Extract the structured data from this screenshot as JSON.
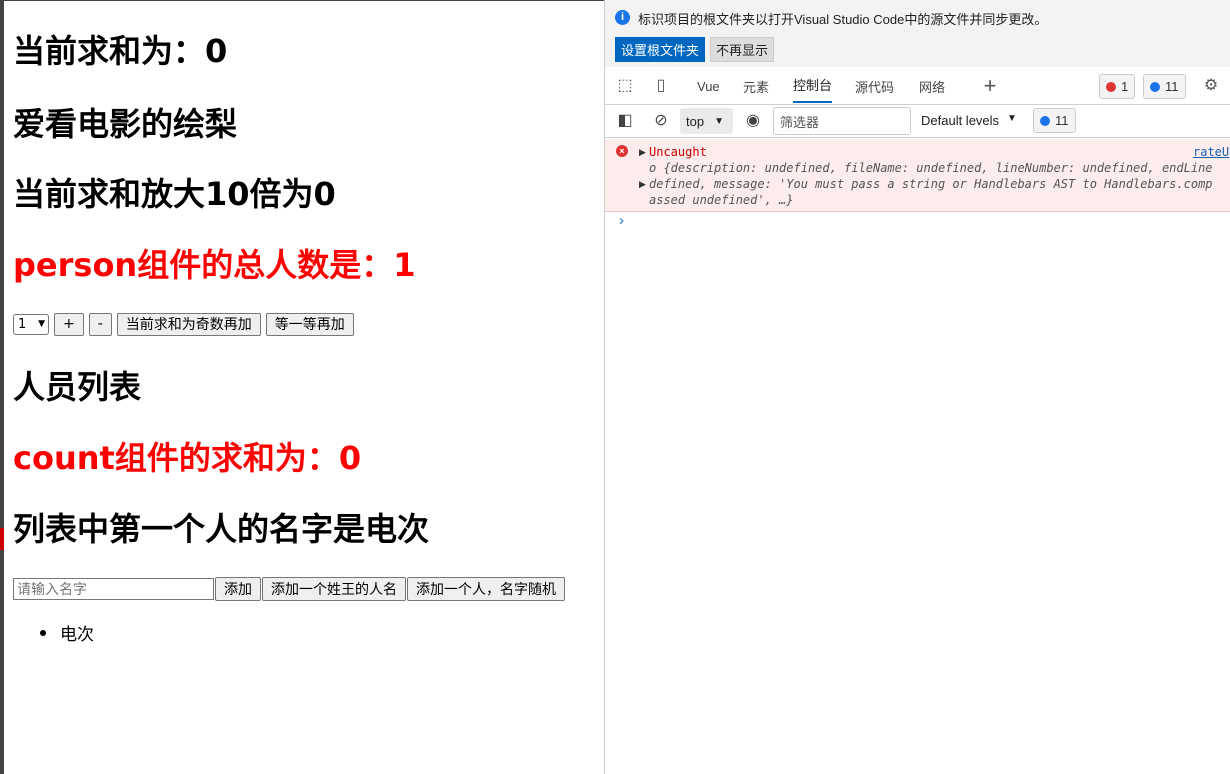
{
  "page": {
    "headings": {
      "sum": "当前求和为：0",
      "hobby": "爱看电影的绘梨",
      "scaled": "当前求和放大10倍为0",
      "person_count": "person组件的总人数是：1",
      "person_list": "人员列表",
      "count_sum": "count组件的求和为：0",
      "first_name": "列表中第一个人的名字是电次"
    },
    "controls": {
      "select_value": "1",
      "plus": "+",
      "minus": "-",
      "odd_add": "当前求和为奇数再加",
      "wait_add": "等一等再加"
    },
    "person_form": {
      "name_placeholder": "请输入名字",
      "add": "添加",
      "add_wang": "添加一个姓王的人名",
      "add_random": "添加一个人，名字随机"
    },
    "list": [
      "电次"
    ]
  },
  "devtools": {
    "infobar": {
      "message": "标识项目的根文件夹以打开Visual Studio Code中的源文件并同步更改。",
      "set_root": "设置根文件夹",
      "dismiss": "不再显示"
    },
    "tabs": [
      "Vue",
      "元素",
      "控制台",
      "源代码",
      "网络"
    ],
    "active_tab": "控制台",
    "error_count": "1",
    "message_count": "11",
    "toolbar": {
      "context": "top",
      "filter_placeholder": "筛选器",
      "levels": "Default levels",
      "messages": "11"
    },
    "error": {
      "title": "Uncaught",
      "source": "rateU",
      "line1": "o {description: undefined, fileName: undefined, lineNumber: undefined, endLine",
      "line2": "defined, message: 'You must pass a string or Handlebars AST to Handlebars.comp",
      "line3": "assed undefined', …}"
    },
    "colors": {
      "accent": "#0067c0",
      "error": "#d33",
      "error_bg": "#fcecec"
    }
  }
}
